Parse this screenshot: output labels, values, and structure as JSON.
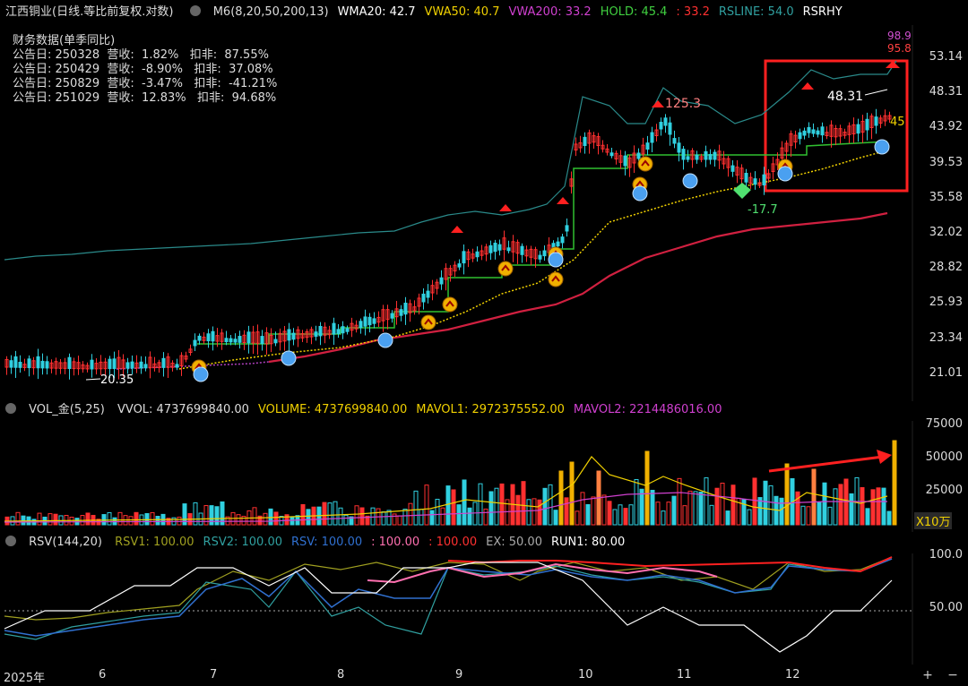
{
  "main_header": {
    "stock": "江西铜业(日线.等比前复权.对数)",
    "items": [
      {
        "text": "M6(8,20,50,200,13)",
        "color": "#dddddd"
      },
      {
        "text": "WMA20: 42.7",
        "color": "#ffffff"
      },
      {
        "text": "VWA50: 40.7",
        "color": "#f0d000"
      },
      {
        "text": "VWA200: 33.2",
        "color": "#d040d0"
      },
      {
        "text": "HOLD: 45.4",
        "color": "#40d040"
      },
      {
        "text": ": 33.2",
        "color": "#ff3030"
      },
      {
        "text": "RSLINE: 54.0",
        "color": "#30a0a0"
      },
      {
        "text": "RSRHY",
        "color": "#ffffff"
      }
    ]
  },
  "financials": {
    "title": "财务数据(单季同比)",
    "rows": [
      "公告日: 250328  营收:  1.82%   扣非:  87.55%",
      "公告日: 250429  营收:  -8.90%   扣非:  37.08%",
      "公告日: 250829  营收:  -3.47%   扣非:  -41.21%",
      "公告日: 251029  营收:  12.83%   扣非:  94.68%"
    ]
  },
  "price_axis": [
    "53.14",
    "48.31",
    "43.92",
    "39.53",
    "35.58",
    "32.02",
    "28.82",
    "25.93",
    "23.34",
    "21.01"
  ],
  "annotations": {
    "high": "125.3",
    "top": "48.31",
    "low": "-17.7",
    "left_low": "20.35",
    "tag45": "45",
    "rs1": "98.9",
    "rs2": "95.8"
  },
  "vol_header": {
    "name": "VOL_金(5,25)",
    "items": [
      {
        "text": "VVOL: 4737699840.00",
        "color": "#dddddd"
      },
      {
        "text": "VOLUME: 4737699840.00",
        "color": "#f0d000"
      },
      {
        "text": "MAVOL1: 2972375552.00",
        "color": "#f0d000"
      },
      {
        "text": "MAVOL2: 2214486016.00",
        "color": "#d040d0"
      }
    ]
  },
  "vol_axis": [
    "75000",
    "50000",
    "25000"
  ],
  "vol_unit": "X10万",
  "rsv_header": {
    "name": "RSV(144,20)",
    "items": [
      {
        "text": "RSV1: 100.00",
        "color": "#a0a020"
      },
      {
        "text": "RSV2: 100.00",
        "color": "#30a0a0"
      },
      {
        "text": "RSV: 100.00",
        "color": "#3070d0"
      },
      {
        "text": ": 100.00",
        "color": "#ff70b0"
      },
      {
        "text": ": 100.00",
        "color": "#ff3030"
      },
      {
        "text": "EX: 50.00",
        "color": "#aaaaaa"
      },
      {
        "text": "RUN1: 80.00",
        "color": "#ffffff"
      }
    ]
  },
  "rsv_axis": [
    "100.0",
    "50.00"
  ],
  "time_axis": [
    {
      "label": "2025年"
    },
    {
      "label": "6"
    },
    {
      "label": "7"
    },
    {
      "label": "8"
    },
    {
      "label": "9"
    },
    {
      "label": "10"
    },
    {
      "label": "11"
    },
    {
      "label": "12"
    }
  ],
  "zoom": {
    "plus": "+",
    "minus": "−"
  },
  "colors": {
    "up": "#ff3030",
    "down": "#30d0e0",
    "hold": "#30c030",
    "wma": "#f0d000",
    "vwa200": "#d02040"
  }
}
